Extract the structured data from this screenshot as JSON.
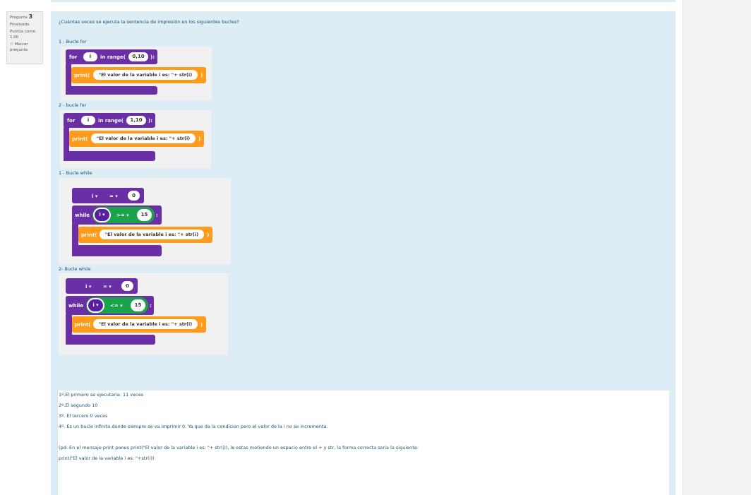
{
  "info": {
    "question_label": "Pregunta",
    "question_number": "3",
    "status": "Finalizado",
    "score_label": "Puntúa como",
    "score": "1,00",
    "flag_label": "Marcar pregunta"
  },
  "question": {
    "text": "¿Cuántas veces se ejecuta la sentencia de impresión en los siguientes bucles?",
    "sections": [
      {
        "label": "1 - Bucle for",
        "var": "i",
        "range": "0,10"
      },
      {
        "label": "2 - bucle for",
        "var": "i",
        "range": "1,10"
      },
      {
        "label": "1 - Bucle while",
        "init": "0",
        "op": ">=",
        "limit": "15"
      },
      {
        "label": "2- Bucle while",
        "init": "0",
        "op": "<=",
        "limit": "15"
      }
    ],
    "blocks": {
      "for_kw": "for",
      "in_range": "in range(",
      "close": "):",
      "print_kw": "print(",
      "print_arg": "\"El valor de la variable i es: \"+ str(i)",
      "print_close": ")",
      "while_kw": "while",
      "colon": ":",
      "var_dd": "i ▾",
      "assign_dd": "= ▾",
      "ge_dd": ">= ▾",
      "le_dd": "<= ▾"
    }
  },
  "answer": {
    "lines": [
      "1º.El primero se ejecutaria: 11 veces",
      "2º.El segundo 10",
      "3º. El tercero 0 veces",
      "4º. Es un bucle infinito donde siempre se va imprimir 0. Ya que da la condicion pero el valor de la i no se incrementa.",
      "(pd: En el mensaje print pones print(\"El valor de la variable i es: \"+ str(i)), le estas metiendo un espacio entre el + y str, la forma correcta seria la siguiente:",
      "print(\"El valor de la variable i es: \"+str(i))"
    ]
  }
}
